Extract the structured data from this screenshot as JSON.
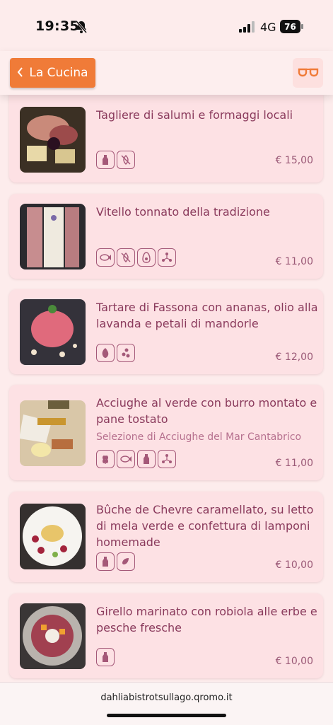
{
  "status": {
    "time": "19:35",
    "network": "4G",
    "battery": "76"
  },
  "topbar": {
    "back_label": "La Cucina"
  },
  "items": [
    {
      "title": "Tagliere di salumi e formaggi locali",
      "subtitle": "",
      "price": "€ 15,00",
      "allergens": [
        "milk-bottle-icon",
        "gluten-free-icon"
      ]
    },
    {
      "title": "Vitello tonnato della tradizione",
      "subtitle": "",
      "price": "€ 11,00",
      "allergens": [
        "fish-icon",
        "gluten-free-icon",
        "egg-icon",
        "sulphites-icon"
      ]
    },
    {
      "title": "Tartare di Fassona con ananas, olio alla lavanda e petali di mandorle",
      "subtitle": "",
      "price": "€ 12,00",
      "allergens": [
        "almond-icon",
        "soy-icon"
      ]
    },
    {
      "title": "Acciughe al verde con burro montato e pane tostato",
      "subtitle": "Selezione di Acciughe del Mar Cantabrico",
      "price": "€ 11,00",
      "allergens": [
        "wheat-icon",
        "fish-icon",
        "milk-bottle-icon",
        "sulphites-icon"
      ]
    },
    {
      "title": "Bûche de Chevre caramellato, su letto di mela verde e confettura di lamponi homemade",
      "subtitle": "",
      "price": "€ 10,00",
      "allergens": [
        "milk-bottle-icon",
        "nuts-icon"
      ]
    },
    {
      "title": "Girello marinato con robiola alle erbe e pesche fresche",
      "subtitle": "",
      "price": "€ 10,00",
      "allergens": [
        "milk-bottle-icon"
      ]
    }
  ],
  "footer": {
    "url": "dahliabistrotsullago.qromo.it"
  }
}
